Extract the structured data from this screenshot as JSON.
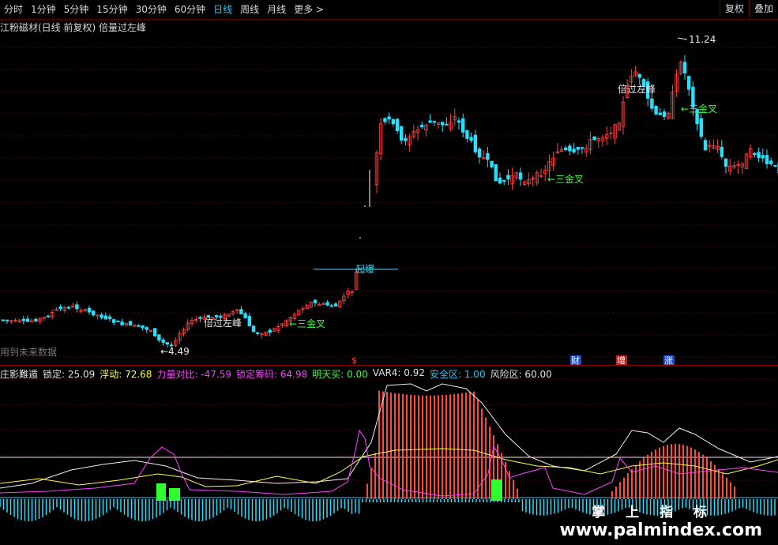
{
  "toolbar": {
    "tabs": [
      "分时",
      "1分钟",
      "5分钟",
      "15分钟",
      "30分钟",
      "60分钟",
      "日线",
      "周线",
      "月线",
      "更多 >"
    ],
    "active_tab": "日线",
    "right_buttons": [
      "复权",
      "叠加"
    ]
  },
  "main_chart": {
    "title": "江粉磁材(日线 前复权) 倍量过左峰",
    "high_label": "11.24",
    "low_label": "4.49",
    "annotations": [
      "倍过左峰",
      "三金叉",
      "起爆",
      "三金叉",
      "倍过左峰",
      "三金叉"
    ],
    "event_markers": [
      "$",
      "财",
      "增",
      "涨"
    ],
    "future_data_text": "用到未来数据"
  },
  "indicator": {
    "name": "庄影難遁",
    "items": [
      {
        "label": "锁定",
        "value": "25.09",
        "color": "#e0e0e0"
      },
      {
        "label": "浮动",
        "value": "72.68",
        "color": "#ffff40"
      },
      {
        "label": "力量对比",
        "value": "-47.59",
        "color": "#ff40ff"
      },
      {
        "label": "锁定筹码",
        "value": "64.98",
        "color": "#ff40ff"
      },
      {
        "label": "明天买",
        "value": "0.00",
        "color": "#40ff40"
      },
      {
        "label": "VAR4",
        "value": "0.92",
        "color": "#e0e0e0"
      },
      {
        "label": "安全区",
        "value": "1.00",
        "color": "#27c7ff"
      },
      {
        "label": "风险区",
        "value": "60.00",
        "color": "#e0e0e0"
      }
    ]
  },
  "watermark": {
    "cn": "掌 上 指 标",
    "url": "www.palmindex.com"
  },
  "colors": {
    "up": "#ff4040",
    "down": "#27e0ff",
    "annotation": "#40ff40",
    "grid": "#5a0000"
  }
}
